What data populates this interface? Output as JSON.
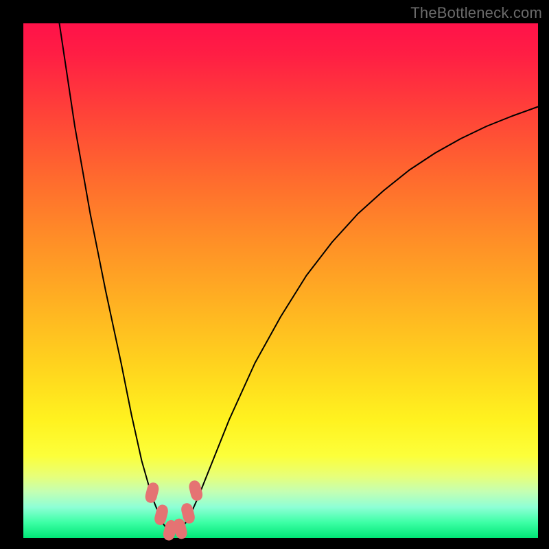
{
  "watermark": "TheBottleneck.com",
  "chart_data": {
    "type": "line",
    "title": "",
    "xlabel": "",
    "ylabel": "",
    "xlim": [
      0,
      100
    ],
    "ylim": [
      0,
      100
    ],
    "grid": false,
    "legend": false,
    "series": [
      {
        "name": "bottleneck-curve",
        "x": [
          7,
          10,
          13,
          16,
          19,
          21,
          23,
          25,
          27,
          28.5,
          30,
          32,
          34,
          36,
          40,
          45,
          50,
          55,
          60,
          65,
          70,
          75,
          80,
          85,
          90,
          95,
          100
        ],
        "y": [
          100,
          80,
          63,
          48,
          34,
          24,
          15,
          8,
          3,
          1,
          1.2,
          3.5,
          8,
          13,
          23,
          34,
          43,
          51,
          57.5,
          63,
          67.5,
          71.5,
          74.8,
          77.6,
          80,
          82,
          83.8
        ]
      }
    ],
    "markers": [
      {
        "x": 25.0,
        "y": 8.8
      },
      {
        "x": 26.8,
        "y": 4.5
      },
      {
        "x": 28.5,
        "y": 1.5
      },
      {
        "x": 30.5,
        "y": 1.8
      },
      {
        "x": 32.0,
        "y": 4.8
      },
      {
        "x": 33.5,
        "y": 9.2
      }
    ],
    "marker_color": "#e57373",
    "curve_color": "#000000",
    "curve_width": 2,
    "background_gradient": [
      "#ff1249",
      "#ff8e27",
      "#fff21f",
      "#00e676"
    ]
  }
}
